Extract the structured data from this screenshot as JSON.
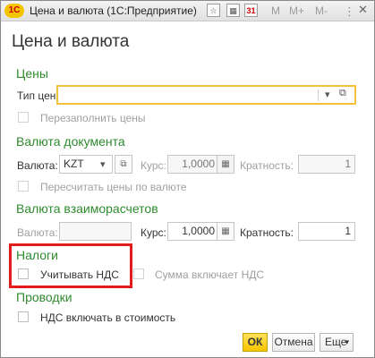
{
  "window": {
    "logo_text": "1С",
    "title": "Цена и валюта (1С:Предприятие)",
    "toolbar": [
      "M",
      "M+",
      "M-"
    ]
  },
  "form": {
    "title": "Цена и валюта"
  },
  "prices": {
    "section": "Цены",
    "type_label": "Тип цен:",
    "type_value": "",
    "refill_label": "Перезаполнить цены"
  },
  "doc_currency": {
    "section": "Валюта документа",
    "currency_label": "Валюта:",
    "currency_value": "KZT",
    "rate_label": "Курс:",
    "rate_value": "1,0000",
    "multiplicity_label": "Кратность:",
    "multiplicity_value": "1",
    "recalc_label": "Пересчитать цены по валюте"
  },
  "settlement_currency": {
    "section": "Валюта взаиморасчетов",
    "currency_label": "Валюта:",
    "rate_label": "Курс:",
    "rate_value": "1,0000",
    "multiplicity_label": "Кратность:",
    "multiplicity_value": "1"
  },
  "taxes": {
    "section": "Налоги",
    "vat_label": "Учитывать НДС",
    "vat_included_label": "Сумма включает НДС"
  },
  "postings": {
    "section": "Проводки",
    "vat_in_cost_label": "НДС включать в стоимость"
  },
  "buttons": {
    "ok": "ОК",
    "cancel": "Отмена",
    "more": "Еще"
  },
  "colors": {
    "section_green": "#2f8a2f",
    "highlight_red": "#e31b1b",
    "ok_yellow": "#f5c400",
    "focus_border": "#f5c13a"
  }
}
